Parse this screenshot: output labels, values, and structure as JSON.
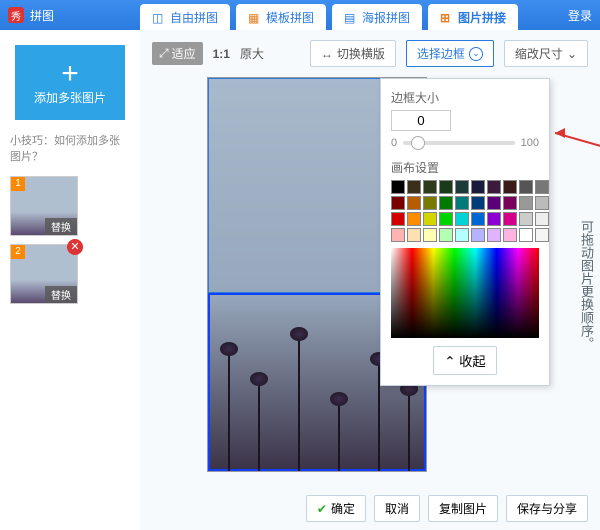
{
  "titlebar": {
    "logo_text": "秀",
    "title": "拼图",
    "login": "登录"
  },
  "tabs": [
    {
      "label": "自由拼图"
    },
    {
      "label": "模板拼图"
    },
    {
      "label": "海报拼图"
    },
    {
      "label": "图片拼接",
      "active": true
    }
  ],
  "sidebar": {
    "add_label": "添加多张图片",
    "tip": "小技巧：如何添加多张图片？",
    "thumbs": [
      {
        "index": "1",
        "caption": "替换"
      },
      {
        "index": "2",
        "caption": "替换",
        "closable": true
      }
    ]
  },
  "toolbar": {
    "adapt": "适应",
    "ratio": "1:1",
    "original": "原大",
    "switch_template": "切换横版",
    "select_border": "选择边框",
    "resize": "缩改尺寸"
  },
  "popup": {
    "border_size_label": "边框大小",
    "border_value": "0",
    "slider_min": "0",
    "slider_max": "100",
    "canvas_settings": "画布设置",
    "collapse": "收起",
    "swatch_rows": [
      [
        "#000000",
        "#3b2e1a",
        "#2e3b1a",
        "#1a3b1a",
        "#1a3b3b",
        "#1a1a3b",
        "#3b1a3b",
        "#3b1a1a",
        "#555555",
        "#777777"
      ],
      [
        "#7a0000",
        "#b85c00",
        "#7a7a00",
        "#007a00",
        "#007a7a",
        "#003b7a",
        "#5c007a",
        "#7a005c",
        "#999999",
        "#bbbbbb"
      ],
      [
        "#d40000",
        "#ff8c00",
        "#d4d400",
        "#00d400",
        "#00d4d4",
        "#0066d4",
        "#8c00d4",
        "#d4008c",
        "#cccccc",
        "#eeeeee"
      ],
      [
        "#ffb3b3",
        "#ffe0b3",
        "#ffffb3",
        "#b3ffb3",
        "#b3ffff",
        "#b3b3ff",
        "#e0b3ff",
        "#ffb3e0",
        "#ffffff",
        "#f5f5f5"
      ]
    ]
  },
  "handnote": "可拖动图片更换顺序。",
  "footer": {
    "ok": "确定",
    "cancel": "取消",
    "copy": "复制图片",
    "save_share": "保存与分享"
  }
}
